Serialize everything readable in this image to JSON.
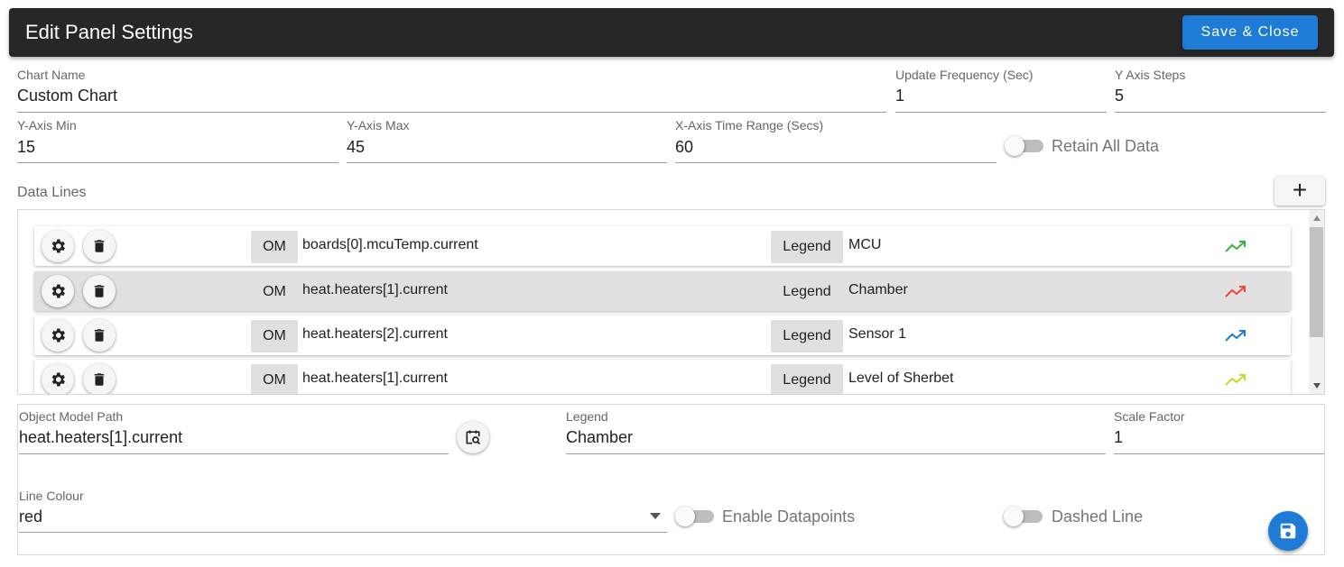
{
  "header": {
    "title": "Edit Panel Settings",
    "save_label": "Save & Close"
  },
  "settings": {
    "chart_name": {
      "label": "Chart Name",
      "value": "Custom Chart"
    },
    "update_frequency": {
      "label": "Update Frequency (Sec)",
      "value": "1"
    },
    "y_axis_steps": {
      "label": "Y Axis Steps",
      "value": "5"
    },
    "y_axis_min": {
      "label": "Y-Axis Min",
      "value": "15"
    },
    "y_axis_max": {
      "label": "Y-Axis Max",
      "value": "45"
    },
    "x_axis_range": {
      "label": "X-Axis Time Range (Secs)",
      "value": "60"
    },
    "retain_all_data": {
      "label": "Retain All Data",
      "on": false
    }
  },
  "data_lines": {
    "title": "Data Lines",
    "add_label": "+",
    "rows": [
      {
        "om_label": "OM",
        "path": "boards[0].mcuTemp.current",
        "legend_label": "Legend",
        "legend": "MCU",
        "color": "#3cb043",
        "selected": false
      },
      {
        "om_label": "OM",
        "path": "heat.heaters[1].current",
        "legend_label": "Legend",
        "legend": "Chamber",
        "color": "#f44336",
        "selected": true
      },
      {
        "om_label": "OM",
        "path": "heat.heaters[2].current",
        "legend_label": "Legend",
        "legend": "Sensor 1",
        "color": "#1e7bd6",
        "selected": false
      },
      {
        "om_label": "OM",
        "path": "heat.heaters[1].current",
        "legend_label": "Legend",
        "legend": "Level of Sherbet",
        "color": "#c6d92a",
        "selected": false
      }
    ]
  },
  "editor": {
    "object_model_path": {
      "label": "Object Model Path",
      "value": "heat.heaters[1].current"
    },
    "legend": {
      "label": "Legend",
      "value": "Chamber"
    },
    "scale_factor": {
      "label": "Scale Factor",
      "value": "1"
    },
    "line_colour": {
      "label": "Line Colour",
      "value": "red"
    },
    "enable_datapoints": {
      "label": "Enable Datapoints",
      "on": false
    },
    "dashed_line": {
      "label": "Dashed Line",
      "on": false
    }
  },
  "icons": {
    "settings": "gear-icon",
    "delete": "trash-icon",
    "trend": "trending-up-icon",
    "browse": "calendar-search-icon",
    "save": "floppy-disk-icon",
    "dropdown": "caret-down-icon"
  },
  "colors": {
    "header_bg": "#272727",
    "accent": "#1e7bd6"
  }
}
